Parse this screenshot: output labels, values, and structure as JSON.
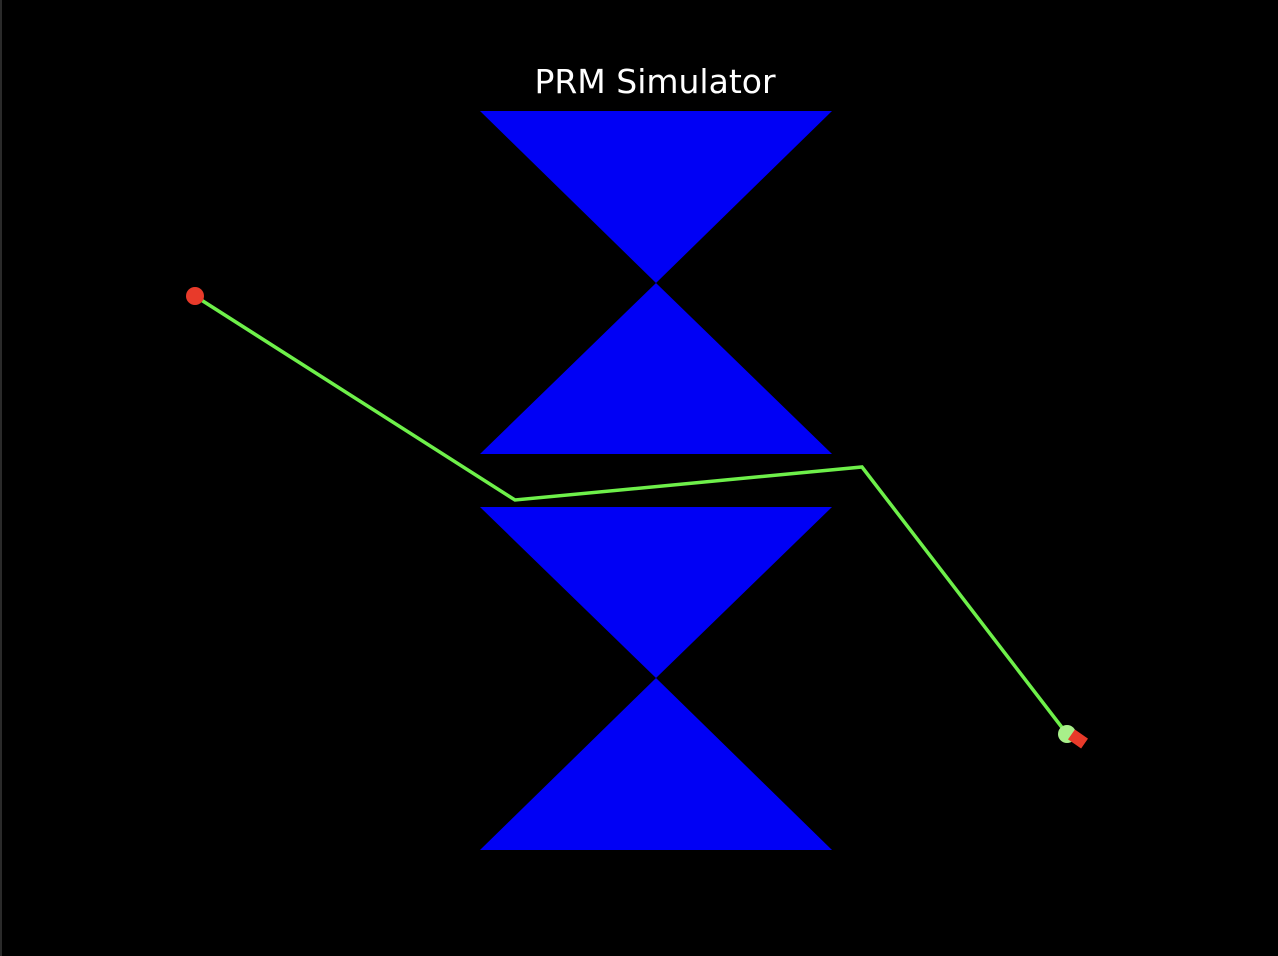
{
  "window": {
    "title": "PRM Simulator"
  },
  "colors": {
    "background": "#000000",
    "obstacle": "#0000f5",
    "path": "#6ef04a",
    "start_marker": "#e83a2a",
    "goal_marker": "#a8f08a",
    "robot": "#e83a2a"
  }
}
